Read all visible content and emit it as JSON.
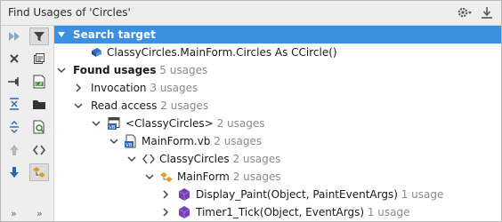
{
  "window": {
    "title": "Find Usages of 'Circles'",
    "icons": [
      "gear-icon",
      "chevron-down-icon",
      "pin-icon"
    ]
  },
  "toolbar": {
    "buttons": [
      "expand-all-icon",
      "filter-icon",
      "close-icon",
      "preview-icon",
      "pin-tab-icon",
      "csharp-file-icon",
      "collapse-all-icon",
      "folder-icon",
      "expand-icon",
      "file-search-icon",
      "previous-icon",
      "namespace-icon",
      "next-icon",
      "group-by-type-icon",
      "more-left-icon",
      "more-right-icon"
    ]
  },
  "tree": {
    "search_target": {
      "label": "Search target"
    },
    "target_item": {
      "label": "ClassyCircles.MainForm.Circles As CCircle()"
    },
    "found_usages": {
      "label": "Found usages",
      "count": "5 usages"
    },
    "invocation": {
      "label": "Invocation",
      "count": "3 usages"
    },
    "read_access": {
      "label": "Read access",
      "count": "2 usages"
    },
    "project": {
      "label": "<ClassyCircles>",
      "count": "2 usages"
    },
    "file": {
      "label": "MainForm.vb",
      "count": "2 usages"
    },
    "namespace": {
      "label": "ClassyCircles",
      "count": "2 usages"
    },
    "class": {
      "label": "MainForm",
      "count": "2 usages"
    },
    "method1": {
      "label": "Display_Paint(Object, PaintEventArgs)",
      "count": "1 usage"
    },
    "method2": {
      "label": "Timer1_Tick(Object, EventArgs)",
      "count": "1 usage"
    }
  },
  "colors": {
    "selection": "#3d8fe0",
    "usage_count": "#8a8a8a",
    "toolbar_bg": "#eeeeee",
    "method_icon": "#7b3fb5",
    "vb_badge": "#2a66b8"
  }
}
